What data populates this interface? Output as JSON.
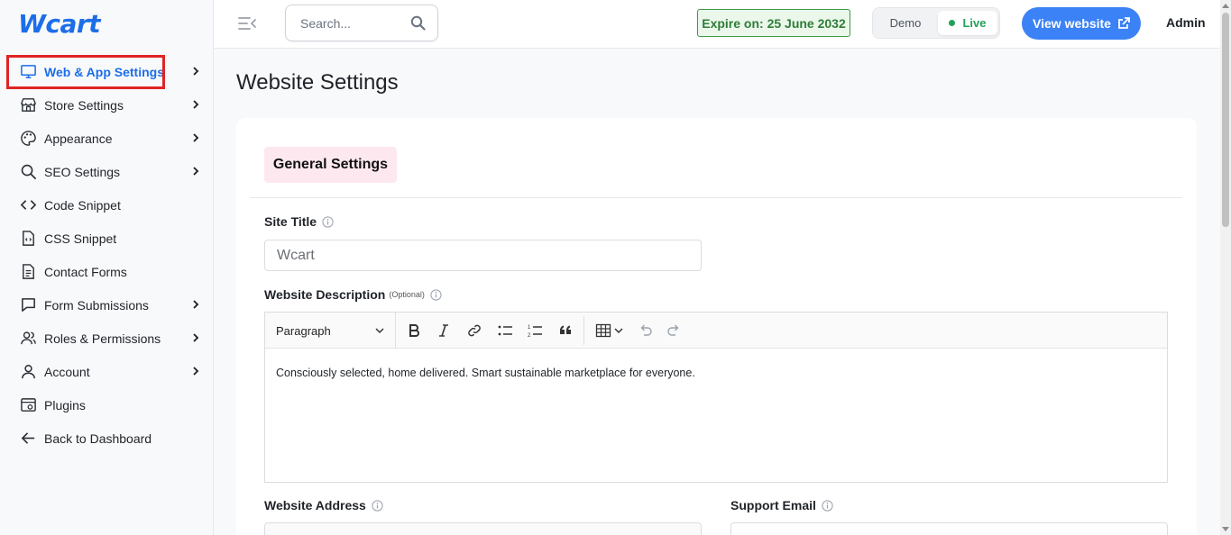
{
  "app": {
    "logo_text": "Wcart",
    "accent_color": "#1c6ee8"
  },
  "sidebar": {
    "items": [
      {
        "label": "Web & App Settings",
        "icon": "monitor-icon",
        "has_chevron": true,
        "active": true
      },
      {
        "label": "Store Settings",
        "icon": "store-icon",
        "has_chevron": true
      },
      {
        "label": "Appearance",
        "icon": "palette-icon",
        "has_chevron": true
      },
      {
        "label": "SEO Settings",
        "icon": "search-icon",
        "has_chevron": true
      },
      {
        "label": "Code Snippet",
        "icon": "code-icon",
        "has_chevron": false
      },
      {
        "label": "CSS Snippet",
        "icon": "file-code-icon",
        "has_chevron": false
      },
      {
        "label": "Contact Forms",
        "icon": "document-icon",
        "has_chevron": false
      },
      {
        "label": "Form Submissions",
        "icon": "message-icon",
        "has_chevron": true
      },
      {
        "label": "Roles & Permissions",
        "icon": "users-icon",
        "has_chevron": true
      },
      {
        "label": "Account",
        "icon": "user-icon",
        "has_chevron": true
      },
      {
        "label": "Plugins",
        "icon": "plugin-icon",
        "has_chevron": false
      },
      {
        "label": "Back to Dashboard",
        "icon": "arrow-left-icon",
        "has_chevron": false
      }
    ]
  },
  "topbar": {
    "search_placeholder": "Search...",
    "expire_text": "Expire on: 25 June 2032",
    "mode_demo": "Demo",
    "mode_live": "Live",
    "view_website_label": "View website",
    "user_label": "Admin"
  },
  "main": {
    "page_title": "Website Settings",
    "section_tab": "General Settings",
    "site_title_label": "Site Title",
    "site_title_value": "Wcart",
    "description_label": "Website Description",
    "description_optional": "(Optional)",
    "editor": {
      "block_format": "Paragraph",
      "content": "Consciously selected, home delivered. Smart sustainable marketplace for everyone."
    },
    "website_address_label": "Website Address",
    "support_email_label": "Support Email"
  }
}
